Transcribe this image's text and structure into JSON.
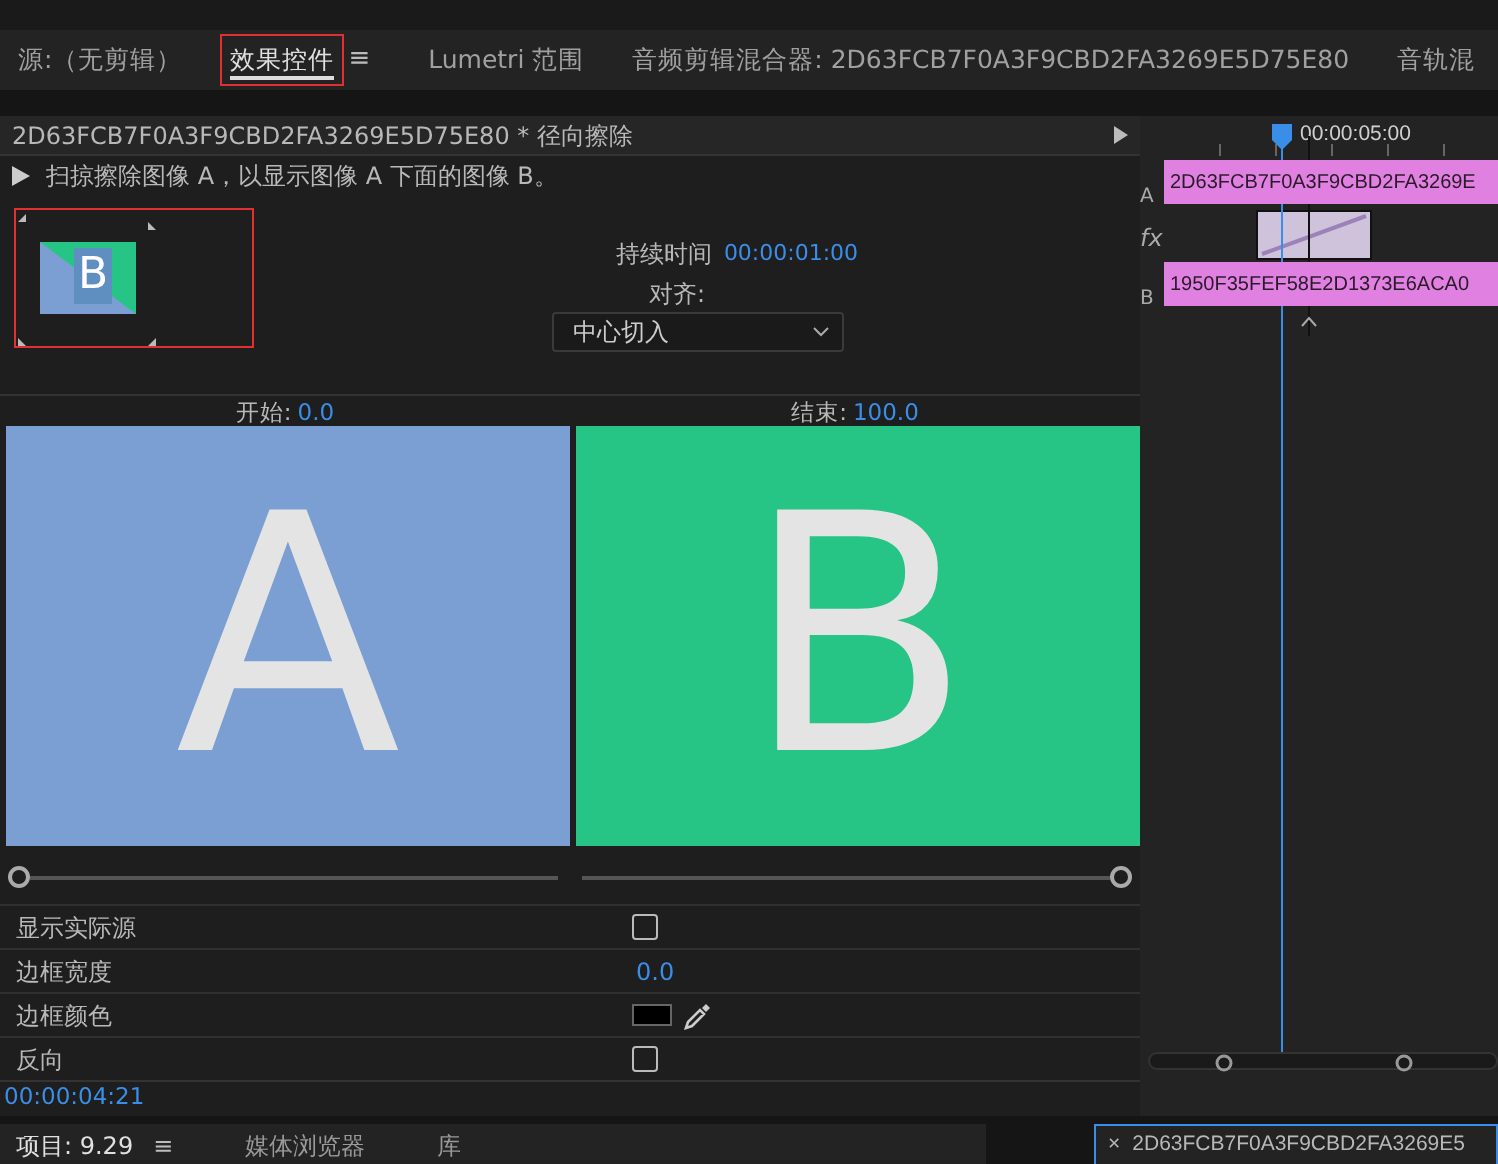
{
  "tabs": [
    {
      "label": "源:（无剪辑）",
      "selected": false,
      "highlighted": false
    },
    {
      "label": "效果控件",
      "selected": true,
      "highlighted": true,
      "menu": "≡"
    },
    {
      "label": "Lumetri 范围",
      "selected": false,
      "highlighted": false
    },
    {
      "label": "音频剪辑混合器: 2D63FCB7F0A3F9CBD2FA3269E5D75E80",
      "selected": false,
      "highlighted": false
    },
    {
      "label": "音轨混",
      "selected": false,
      "highlighted": false
    }
  ],
  "effect": {
    "clip_name": "2D63FCB7F0A3F9CBD2FA3269E5D75E80",
    "effect_name": "* 径向擦除",
    "description": "扫掠擦除图像 A，以显示图像 A 下面的图像 B。"
  },
  "thumbnail": {
    "letter": "B",
    "highlighted": true
  },
  "duration": {
    "label": "持续时间",
    "value": "00:00:01:00"
  },
  "alignment": {
    "label": "对齐:",
    "value": "中心切入"
  },
  "preview": {
    "start_label": "开始:",
    "start_value": "0.0",
    "end_label": "结束:",
    "end_value": "100.0",
    "start_letter": "A",
    "end_letter": "B"
  },
  "sliders": [
    {
      "level": 0
    },
    {
      "level": 1
    }
  ],
  "properties": [
    {
      "kind": "checkbox",
      "label": "显示实际源",
      "checked": false
    },
    {
      "kind": "number",
      "label": "边框宽度",
      "value": "0.0"
    },
    {
      "kind": "color",
      "label": "边框颜色",
      "color": "#000000"
    },
    {
      "kind": "checkbox",
      "label": "反向",
      "checked": false
    }
  ],
  "timecode": "00:00:04:21",
  "timeline": {
    "ruler_time": "00:00:05:00",
    "track_a": {
      "letter": "A",
      "clip": "2D63FCB7F0A3F9CBD2FA3269E"
    },
    "fx": "fx",
    "track_b": {
      "letter": "B",
      "clip": "1950F35FEF58E2D1373E6ACA0"
    }
  },
  "bottom_tabs": [
    {
      "label": "项目: 9.29",
      "menu": "≡",
      "selected": true
    },
    {
      "label": "媒体浏览器",
      "selected": false
    },
    {
      "label": "库",
      "selected": false
    }
  ],
  "sequence_tab": {
    "close": "×",
    "label": "2D63FCB7F0A3F9CBD2FA3269E5"
  }
}
